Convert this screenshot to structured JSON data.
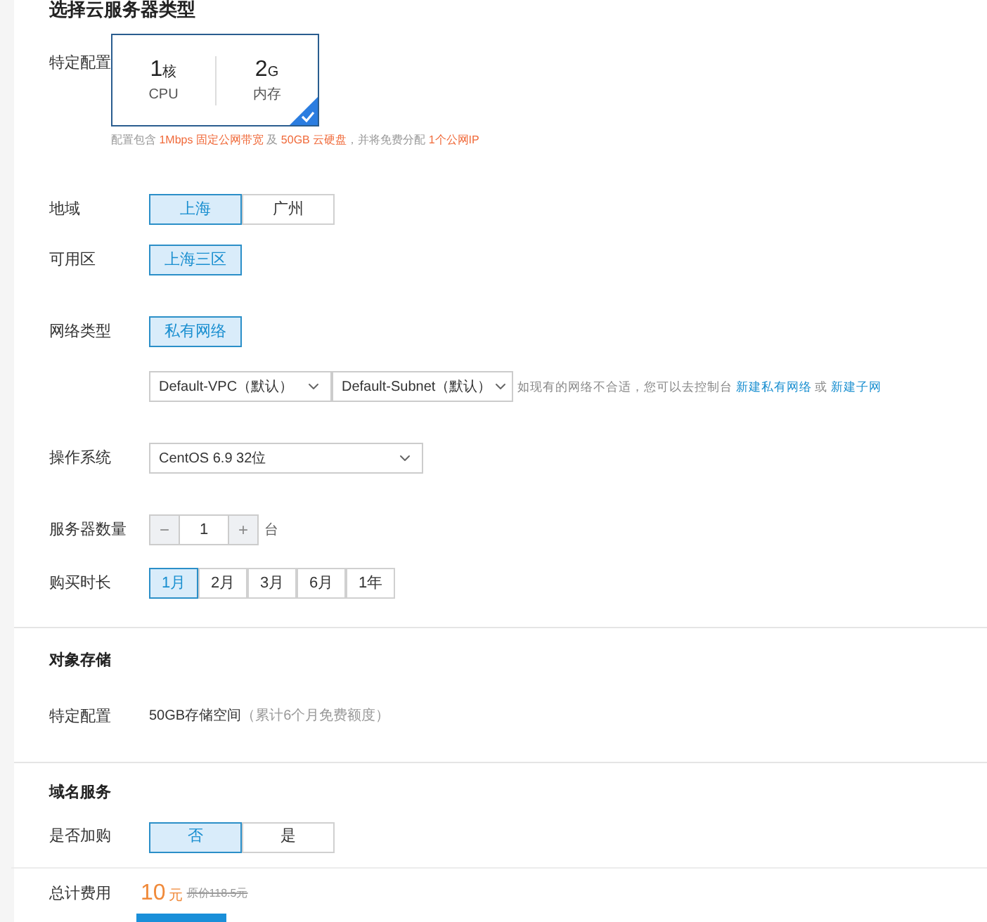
{
  "section_title": "选择云服务器类型",
  "server": {
    "config_label": "特定配置",
    "config_card": {
      "selected": true,
      "specs": [
        {
          "value": "1",
          "unit": "核",
          "label": "CPU"
        },
        {
          "value": "2",
          "unit": "G",
          "label": "内存"
        }
      ]
    },
    "note": [
      {
        "text": "配置包含 ",
        "highlight": false
      },
      {
        "text": "1Mbps 固定公网带宽",
        "highlight": true
      },
      {
        "text": " 及 ",
        "highlight": false
      },
      {
        "text": "50GB 云硬盘",
        "highlight": true
      },
      {
        "text": "，并将免费分配 ",
        "highlight": false
      },
      {
        "text": "1个公网IP",
        "highlight": true
      }
    ]
  },
  "rows": [
    {
      "kind": "buttons",
      "label": "地域",
      "options": [
        {
          "text": "上海",
          "selected": true
        },
        {
          "text": "广州",
          "selected": false
        }
      ]
    },
    {
      "kind": "buttons",
      "label": "可用区",
      "options": [
        {
          "text": "上海三区",
          "selected": true
        }
      ]
    },
    {
      "kind": "buttons",
      "label": "网络类型",
      "options": [
        {
          "text": "私有网络",
          "selected": true
        }
      ]
    },
    {
      "kind": "network",
      "selects": [
        "Default-VPC（默认）",
        "Default-Subnet（默认）"
      ],
      "hint": [
        {
          "text": "如现有的网络不合适，您可以去控制台 ",
          "link": false
        },
        {
          "text": "新建私有网络",
          "link": true
        },
        {
          "text": " 或 ",
          "link": false
        },
        {
          "text": "新建子网",
          "link": true
        }
      ]
    },
    {
      "kind": "select",
      "label": "操作系统",
      "value": "CentOS 6.9 32位"
    },
    {
      "kind": "stepper",
      "label": "服务器数量",
      "minus": "−",
      "value": "1",
      "plus": "+",
      "unit": "台"
    },
    {
      "kind": "segmented",
      "label": "购买时长",
      "options": [
        {
          "text": "1月",
          "selected": true
        },
        {
          "text": "2月",
          "selected": false
        },
        {
          "text": "3月",
          "selected": false
        },
        {
          "text": "6月",
          "selected": false
        },
        {
          "text": "1年",
          "selected": false
        }
      ]
    }
  ],
  "storage": {
    "title": "对象存储",
    "label": "特定配置",
    "value": "50GB存储空间",
    "note": "（累计6个月免费额度）"
  },
  "domain": {
    "title": "域名服务",
    "label": "是否加购",
    "options": [
      {
        "text": "否",
        "selected": true
      },
      {
        "text": "是",
        "selected": false
      }
    ]
  },
  "total": {
    "label": "总计费用",
    "amount": "10",
    "unit": "元",
    "original": "原价118.5元"
  }
}
